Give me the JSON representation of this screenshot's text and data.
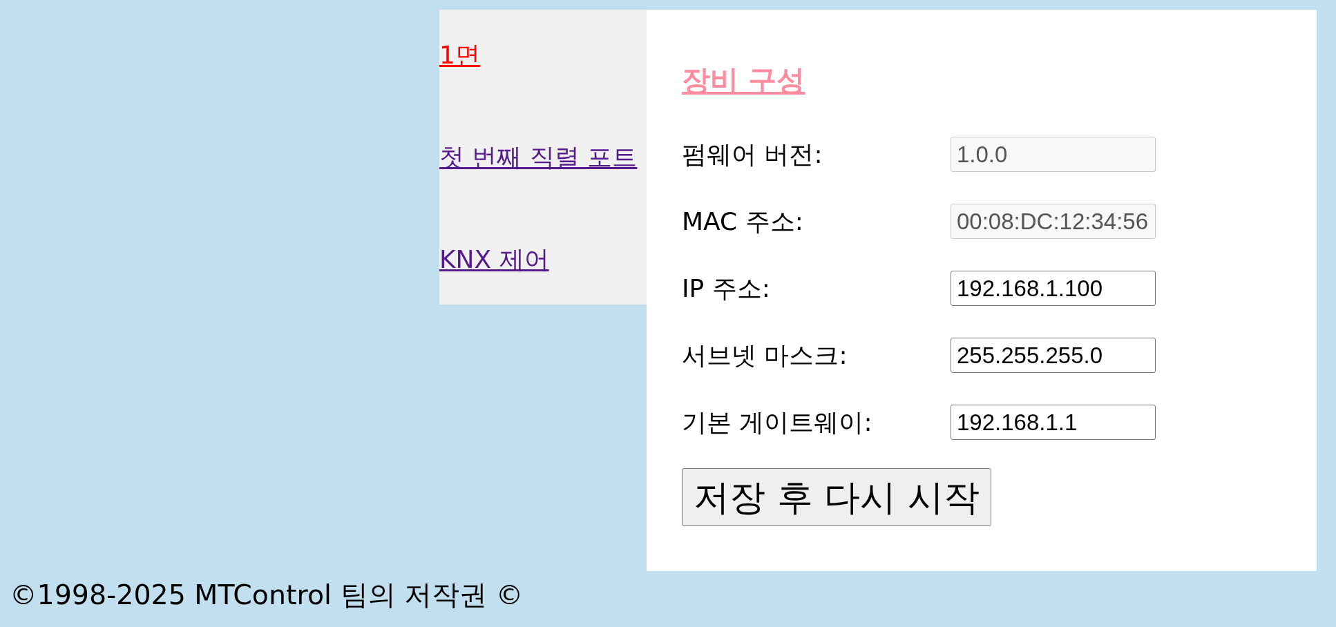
{
  "nav": {
    "links": [
      {
        "label": "1면",
        "selected": true
      },
      {
        "label": "첫 번째 직렬 포트",
        "selected": false
      },
      {
        "label": "KNX 제어",
        "selected": false
      }
    ]
  },
  "panel": {
    "title": "장비 구성",
    "fields": [
      {
        "label": "펌웨어 버전:",
        "value": "1.0.0",
        "disabled": true
      },
      {
        "label": "MAC 주소:",
        "value": "00:08:DC:12:34:56",
        "disabled": true
      },
      {
        "label": "IP 주소:",
        "value": "192.168.1.100",
        "disabled": false
      },
      {
        "label": "서브넷 마스크:",
        "value": "255.255.255.0",
        "disabled": false
      },
      {
        "label": "기본 게이트웨이:",
        "value": "192.168.1.1",
        "disabled": false
      }
    ],
    "button": "저장 후 다시 시작"
  },
  "footer": {
    "text": "©1998-2025 MTControl 팀의 저작권 ©"
  }
}
